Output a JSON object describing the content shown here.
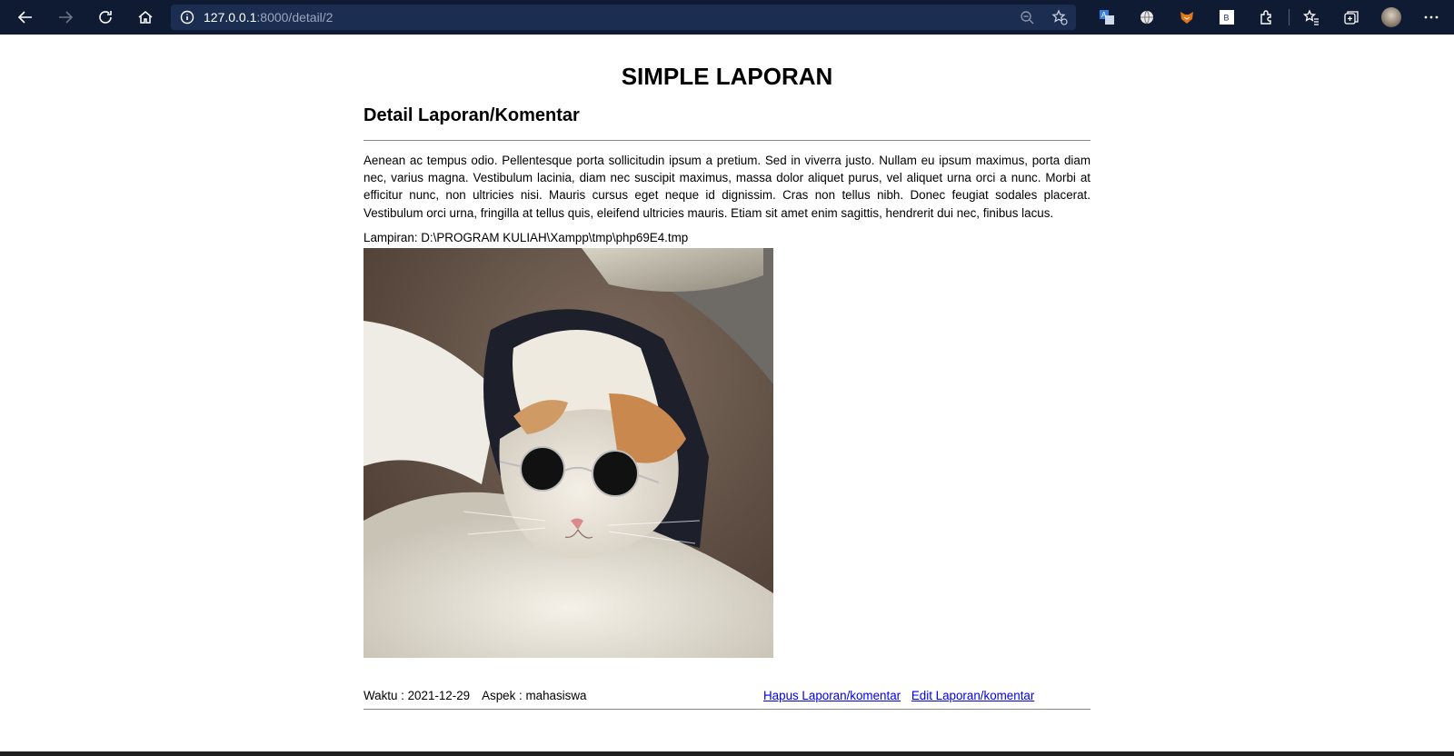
{
  "browser": {
    "url_host": "127.0.0.1",
    "url_rest": ":8000/detail/2",
    "icons": [
      "back-icon",
      "forward-icon",
      "refresh-icon",
      "home-icon",
      "info-icon",
      "zoom-out-icon",
      "favorite-add-icon",
      "translate-icon",
      "globe-icon",
      "fox-extension-icon",
      "b-extension-icon",
      "extensions-icon",
      "favorites-icon",
      "collections-icon",
      "profile-avatar",
      "more-icon"
    ]
  },
  "page": {
    "site_title": "SIMPLE LAPORAN",
    "section_title": "Detail Laporan/Komentar",
    "body": "Aenean ac tempus odio. Pellentesque porta sollicitudin ipsum a pretium. Sed in viverra justo. Nullam eu ipsum maximus, porta diam nec, varius magna. Vestibulum lacinia, diam nec suscipit maximus, massa dolor aliquet purus, vel aliquet urna orci a nunc. Morbi at efficitur nunc, non ultricies nisi. Mauris cursus eget neque id dignissim. Cras non tellus nibh. Donec feugiat sodales placerat. Vestibulum orci urna, fringilla at tellus quis, eleifend ultricies mauris. Etiam sit amet enim sagittis, hendrerit dui nec, finibus lacus.",
    "attachment_label": "Lampiran: D:\\PROGRAM KULIAH\\Xampp\\tmp\\php69E4.tmp",
    "waktu": "Waktu : 2021-12-29",
    "aspek": "Aspek : mahasiswa",
    "delete_link": "Hapus Laporan/komentar",
    "edit_link": "Edit Laporan/komentar"
  }
}
